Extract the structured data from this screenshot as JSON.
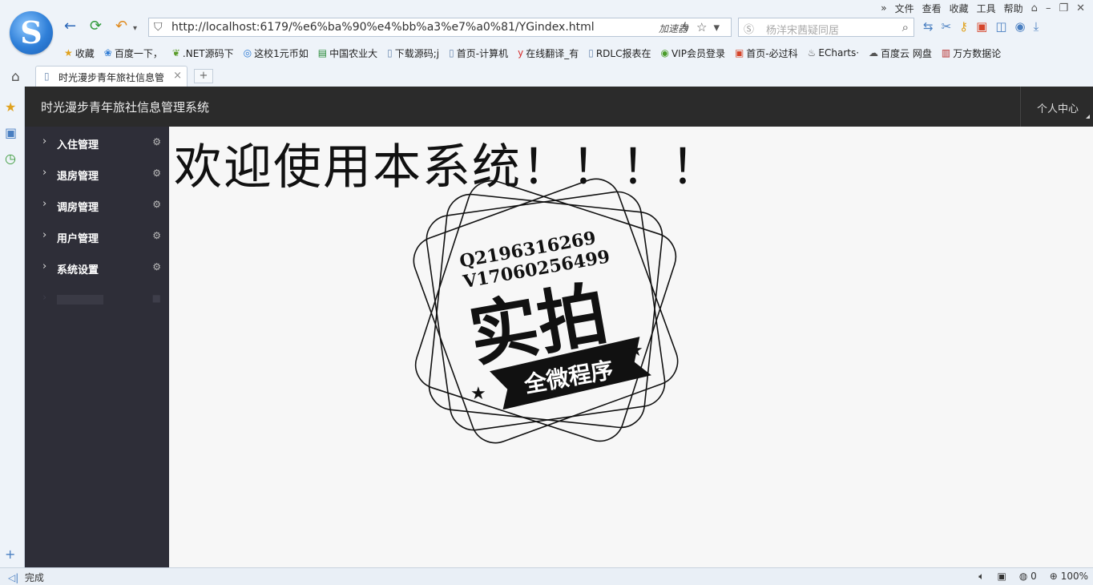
{
  "browser": {
    "menu": [
      "文件",
      "查看",
      "收藏",
      "工具",
      "帮助"
    ],
    "url": "http://localhost:6179/%e6%ba%90%e4%bb%a3%e7%a0%81/YGindex.html",
    "accelerator": "加速器",
    "search_placeholder": "杨洋宋茜疑同居",
    "bookmarks": [
      "收藏",
      "百度一下，",
      ".NET源码下",
      "这校1元币如",
      "中国农业大",
      "下载源码;j",
      "首页-计算机",
      "在线翻译_有",
      "RDLC报表在",
      "VIP会员登录",
      "首页-必过科",
      "ECharts·",
      "百度云 网盘",
      "万方数据论"
    ],
    "tab_title": "时光漫步青年旅社信息管",
    "status_left": "完成",
    "status_count": "0",
    "zoom": "100%"
  },
  "app": {
    "title": "时光漫步青年旅社信息管理系统",
    "user_center": "个人中心",
    "sidebar": [
      {
        "label": "入住管理"
      },
      {
        "label": "退房管理"
      },
      {
        "label": "调房管理"
      },
      {
        "label": "用户管理"
      },
      {
        "label": "系统设置"
      }
    ],
    "welcome": "欢迎使用本系统！！！！"
  },
  "stamp": {
    "line1": "Q2196316269",
    "line2": "V17060256499",
    "main": "实拍",
    "banner": "全微程序"
  },
  "colors": {
    "header_bg": "#2b2b2b",
    "sidebar_bg": "#2e2e38",
    "main_bg": "#f7f7f7"
  }
}
